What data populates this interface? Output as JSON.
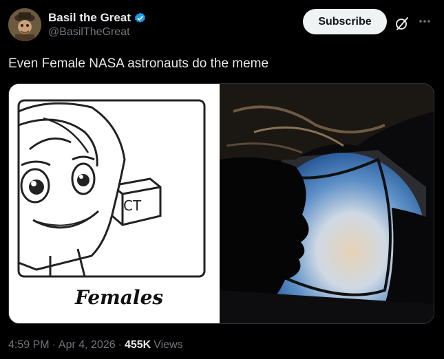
{
  "author": {
    "display_name": "Basil the Great",
    "handle": "@BasilTheGreat",
    "verified": true
  },
  "actions": {
    "subscribe_label": "Subscribe",
    "more_icon": "more-icon",
    "grok_icon": "grok-icon"
  },
  "tweet": {
    "text": "Even Female NASA astronauts do the meme",
    "media": {
      "left_caption": "Females",
      "box_label": "CT"
    }
  },
  "meta": {
    "time": "4:59 PM",
    "sep1": "·",
    "date": "Apr 4, 2026",
    "sep2": "·",
    "views_count": "455K",
    "views_label": "Views"
  },
  "colors": {
    "background": "#000000",
    "text": "#e7e9ea",
    "secondary": "#71767b",
    "verified": "#1d9bf0"
  }
}
